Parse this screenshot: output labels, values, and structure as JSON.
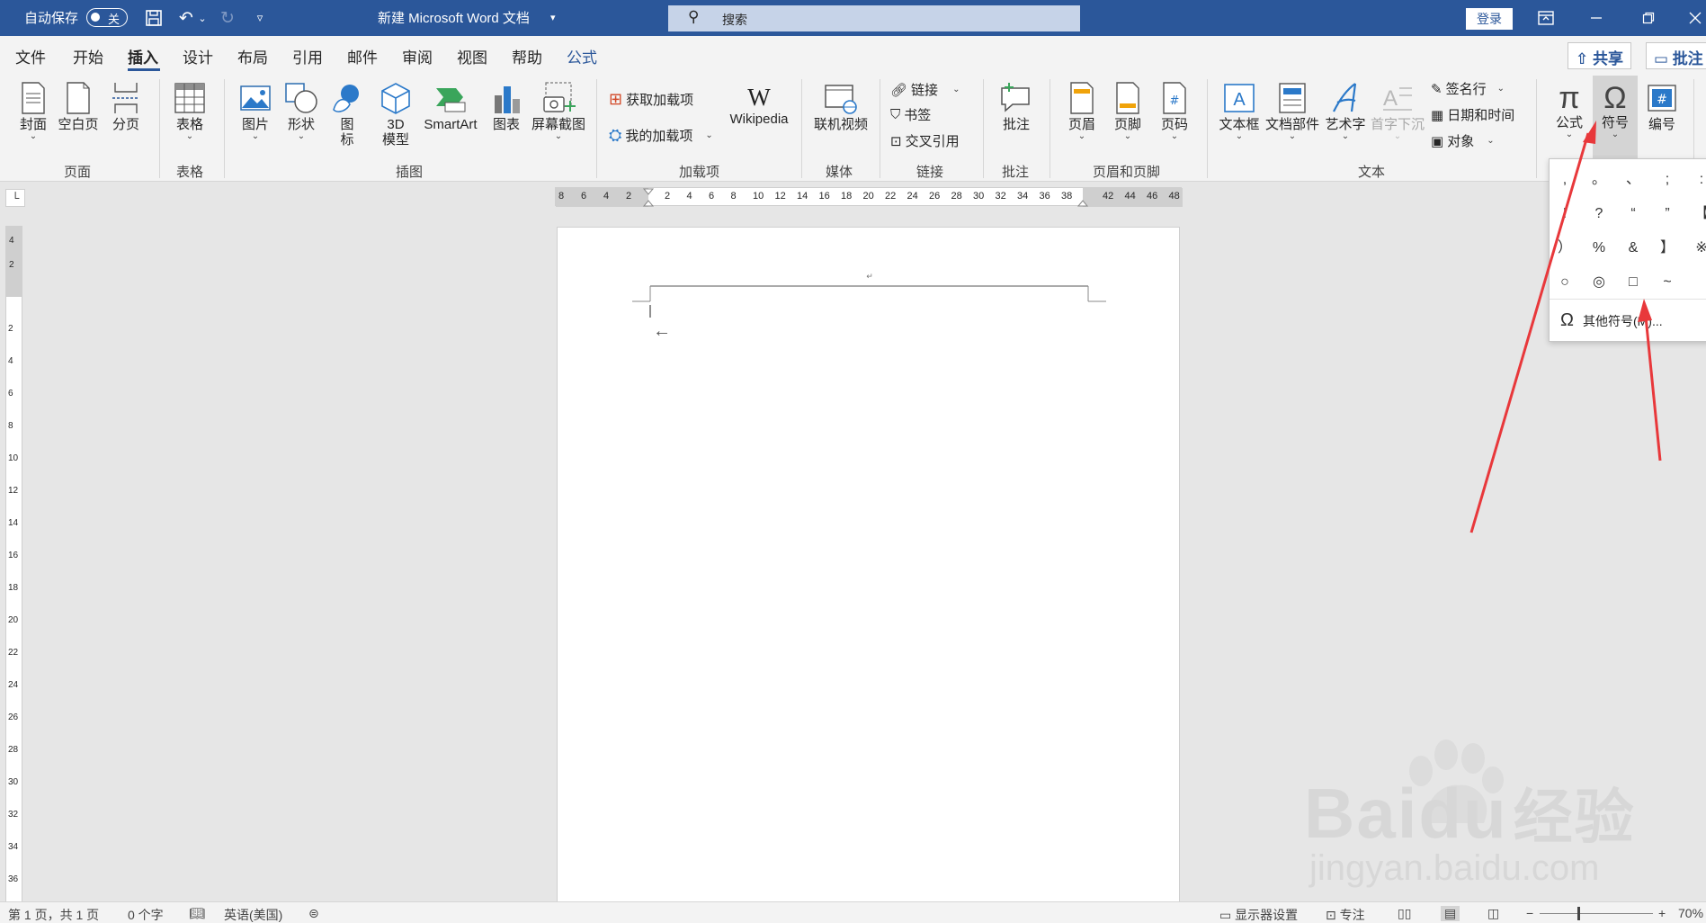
{
  "titlebar": {
    "autosave_label": "自动保存",
    "autosave_state": "关",
    "doc_title": "新建 Microsoft Word 文档",
    "search_placeholder": "搜索",
    "login_label": "登录"
  },
  "tabs": [
    "文件",
    "开始",
    "插入",
    "设计",
    "布局",
    "引用",
    "邮件",
    "审阅",
    "视图",
    "帮助",
    "公式"
  ],
  "active_tab": "插入",
  "share": {
    "share_label": "共享",
    "comment_label": "批注"
  },
  "ribbon": {
    "pages": {
      "cover": "封面",
      "blank": "空白页",
      "break": "分页",
      "group": "页面"
    },
    "tables": {
      "table": "表格",
      "group": "表格"
    },
    "illustrations": {
      "picture": "图片",
      "shapes": "形状",
      "icons_1": "图",
      "icons_2": "标",
      "model_1": "3D",
      "model_2": "模型",
      "smartart": "SmartArt",
      "chart": "图表",
      "screenshot": "屏幕截图",
      "group": "插图"
    },
    "addins": {
      "get": "获取加载项",
      "mine": "我的加载项",
      "wikipedia": "Wikipedia",
      "group": "加载项"
    },
    "media": {
      "video": "联机视频",
      "group": "媒体"
    },
    "links": {
      "link": "链接",
      "bookmark": "书签",
      "crossref": "交叉引用",
      "group": "链接"
    },
    "comments": {
      "comment": "批注",
      "group": "批注"
    },
    "headerfooter": {
      "header": "页眉",
      "footer": "页脚",
      "pagenum": "页码",
      "group": "页眉和页脚"
    },
    "text": {
      "textbox": "文本框",
      "parts": "文档部件",
      "wordart": "艺术字",
      "dropcap": "首字下沉",
      "signature": "签名行",
      "datetime": "日期和时间",
      "object": "对象",
      "group": "文本"
    },
    "symbols": {
      "equation": "公式",
      "symbol": "符号",
      "number": "编号"
    }
  },
  "ruler": {
    "h_left": [
      "8",
      "6",
      "4",
      "2"
    ],
    "h_ticks": [
      "2",
      "4",
      "6",
      "8",
      "10",
      "12",
      "14",
      "16",
      "18",
      "20",
      "22",
      "24",
      "26",
      "28",
      "30",
      "32",
      "34",
      "36",
      "38"
    ],
    "h_right": [
      "42",
      "44",
      "46",
      "48"
    ],
    "v_top": [
      "4",
      "2"
    ],
    "v_ticks": [
      "2",
      "4",
      "6",
      "8",
      "10",
      "12",
      "14",
      "16",
      "18",
      "20",
      "22",
      "24",
      "26",
      "28",
      "30",
      "32",
      "34",
      "36"
    ]
  },
  "symbol_dropdown": {
    "symbols": [
      ",",
      "。",
      "、",
      ";",
      ":",
      "!",
      "?",
      "“",
      "”",
      "【",
      "）",
      "%",
      "&",
      "】",
      "※",
      "○",
      "◎",
      "□",
      "~"
    ],
    "more_label": "其他符号(M)..."
  },
  "status": {
    "page": "第 1 页，共 1 页",
    "words": "0 个字",
    "language": "英语(美国)",
    "display": "显示器设置",
    "focus": "专注",
    "zoom_minus": "−",
    "zoom_plus": "+",
    "zoom_level": "70%"
  },
  "watermark": {
    "brand": "Baidu",
    "cn": "经验",
    "url": "jingyan.baidu.com"
  },
  "colors": {
    "title_bar": "#2b579a",
    "ribbon": "#f3f3f3",
    "arrow": "#e8383b"
  }
}
